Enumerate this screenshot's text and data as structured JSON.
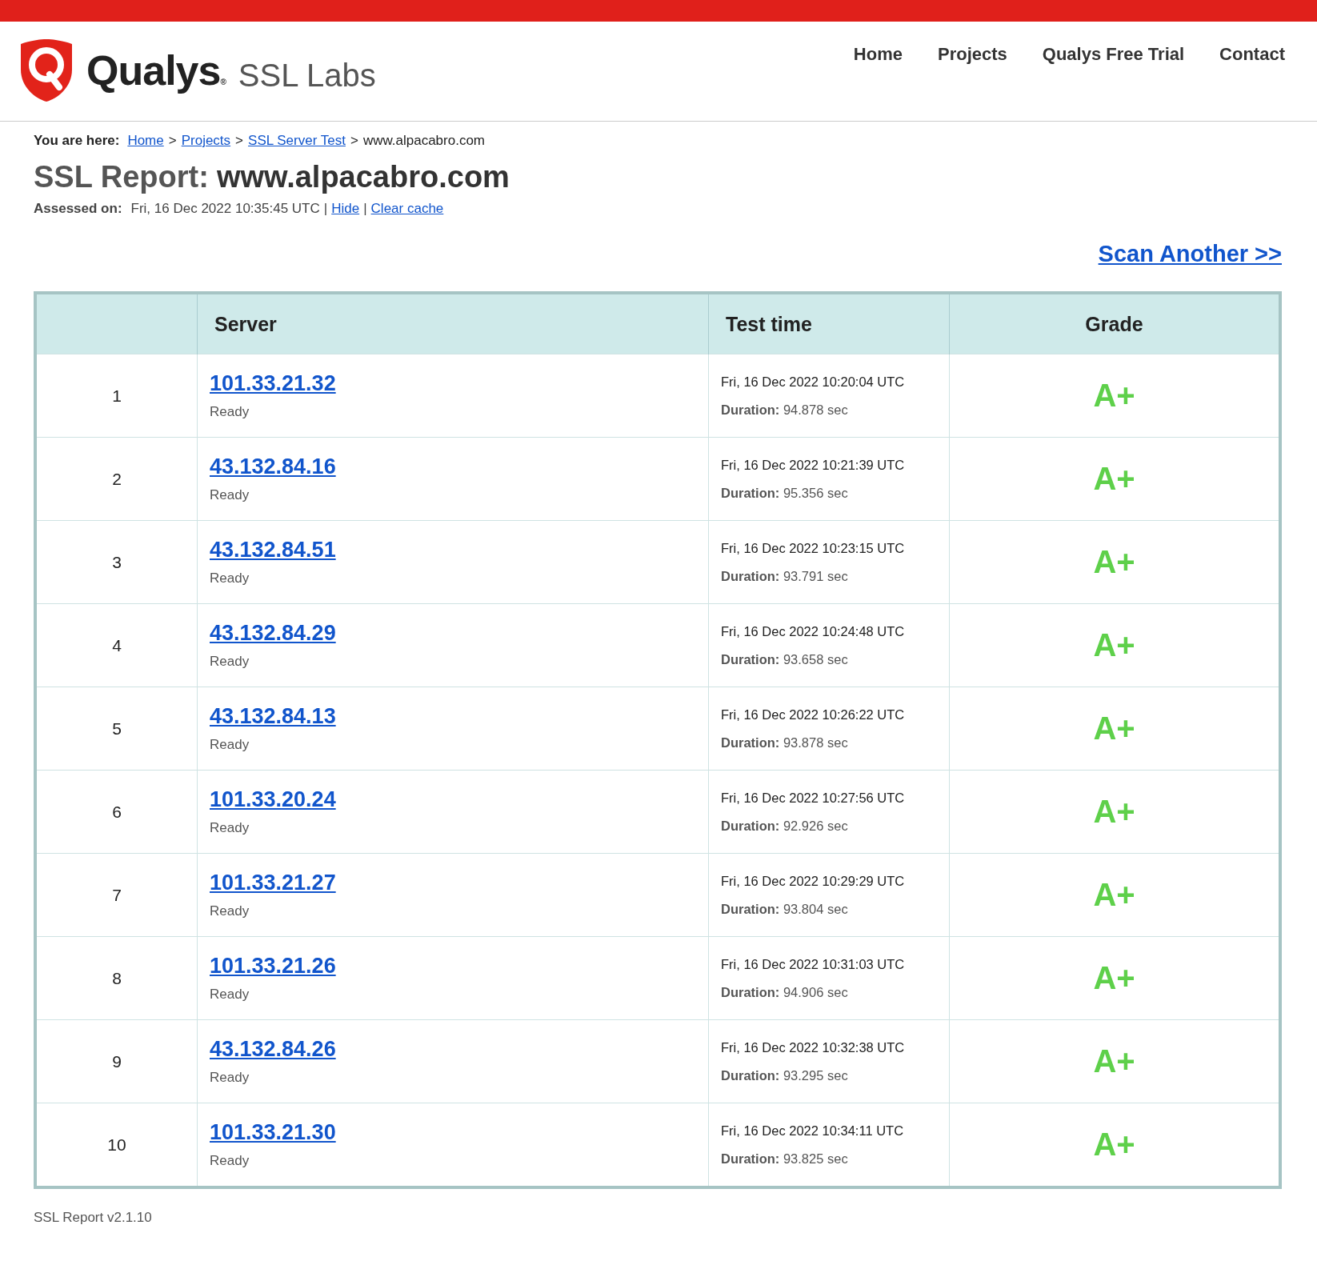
{
  "header": {
    "brand": "Qualys",
    "brand_mark": "®",
    "product": "SSL Labs",
    "nav": [
      {
        "label": "Home"
      },
      {
        "label": "Projects"
      },
      {
        "label": "Qualys Free Trial"
      },
      {
        "label": "Contact"
      }
    ]
  },
  "breadcrumb": {
    "label": "You are here:",
    "links": [
      "Home",
      "Projects",
      "SSL Server Test"
    ],
    "separator": ">",
    "current": "www.alpacabro.com"
  },
  "report": {
    "title_label": "SSL Report:",
    "title_host": "www.alpacabro.com",
    "assessed_label": "Assessed on:",
    "assessed_value": "Fri, 16 Dec 2022 10:35:45 UTC",
    "separator": "|",
    "links": [
      "Hide",
      "Clear cache"
    ],
    "scan_another": "Scan Another >>"
  },
  "table": {
    "columns": [
      "",
      "Server",
      "Test time",
      "Grade"
    ],
    "rows": [
      {
        "index": "1",
        "ip": "101.33.21.32",
        "status": "Ready",
        "time": "Fri, 16 Dec 2022 10:20:04 UTC",
        "duration": "**Duration:** 94.878 sec",
        "grade": "A+"
      },
      {
        "index": "2",
        "ip": "43.132.84.16",
        "status": "Ready",
        "time": "Fri, 16 Dec 2022 10:21:39 UTC",
        "duration": "**Duration:** 95.356 sec",
        "grade": "A+"
      },
      {
        "index": "3",
        "ip": "43.132.84.51",
        "status": "Ready",
        "time": "Fri, 16 Dec 2022 10:23:15 UTC",
        "duration": "**Duration:** 93.791 sec",
        "grade": "A+"
      },
      {
        "index": "4",
        "ip": "43.132.84.29",
        "status": "Ready",
        "time": "Fri, 16 Dec 2022 10:24:48 UTC",
        "duration": "**Duration:** 93.658 sec",
        "grade": "A+"
      },
      {
        "index": "5",
        "ip": "43.132.84.13",
        "status": "Ready",
        "time": "Fri, 16 Dec 2022 10:26:22 UTC",
        "duration": "**Duration:** 93.878 sec",
        "grade": "A+"
      },
      {
        "index": "6",
        "ip": "101.33.20.24",
        "status": "Ready",
        "time": "Fri, 16 Dec 2022 10:27:56 UTC",
        "duration": "**Duration:** 92.926 sec",
        "grade": "A+"
      },
      {
        "index": "7",
        "ip": "101.33.21.27",
        "status": "Ready",
        "time": "Fri, 16 Dec 2022 10:29:29 UTC",
        "duration": "**Duration:** 93.804 sec",
        "grade": "A+"
      },
      {
        "index": "8",
        "ip": "101.33.21.26",
        "status": "Ready",
        "time": "Fri, 16 Dec 2022 10:31:03 UTC",
        "duration": "**Duration:** 94.906 sec",
        "grade": "A+"
      },
      {
        "index": "9",
        "ip": "43.132.84.26",
        "status": "Ready",
        "time": "Fri, 16 Dec 2022 10:32:38 UTC",
        "duration": "**Duration:** 93.295 sec",
        "grade": "A+"
      },
      {
        "index": "10",
        "ip": "101.33.21.30",
        "status": "Ready",
        "time": "Fri, 16 Dec 2022 10:34:11 UTC",
        "duration": "**Duration:** 93.825 sec",
        "grade": "A+"
      }
    ]
  },
  "footer": {
    "version": "SSL Report v2.1.10"
  }
}
